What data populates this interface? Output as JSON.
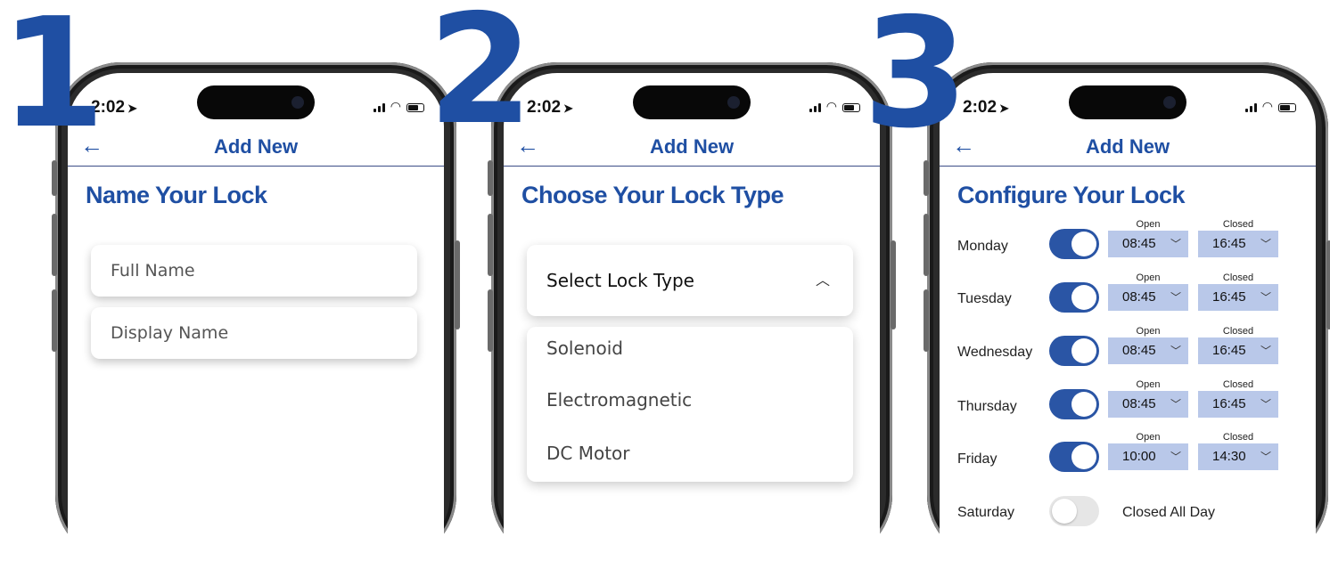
{
  "status": {
    "time": "2:02"
  },
  "nav": {
    "back_icon": "←",
    "title": "Add New"
  },
  "steps": [
    "1",
    "2",
    "3"
  ],
  "screen1": {
    "heading": "Name Your Lock",
    "full_name_placeholder": "Full Name",
    "display_name_placeholder": "Display Name"
  },
  "screen2": {
    "heading": "Choose Your Lock Type",
    "select_label": "Select Lock Type",
    "options": [
      "Solenoid",
      "Electromagnetic",
      "DC Motor"
    ]
  },
  "screen3": {
    "heading": "Configure Your Lock",
    "open_label": "Open",
    "closed_label": "Closed",
    "closed_all_day": "Closed All Day",
    "days": [
      {
        "name": "Monday",
        "enabled": true,
        "open": "08:45",
        "closed": "16:45"
      },
      {
        "name": "Tuesday",
        "enabled": true,
        "open": "08:45",
        "closed": "16:45"
      },
      {
        "name": "Wednesday",
        "enabled": true,
        "open": "08:45",
        "closed": "16:45"
      },
      {
        "name": "Thursday",
        "enabled": true,
        "open": "08:45",
        "closed": "16:45"
      },
      {
        "name": "Friday",
        "enabled": true,
        "open": "10:00",
        "closed": "14:30"
      },
      {
        "name": "Saturday",
        "enabled": false
      }
    ]
  },
  "colors": {
    "accent": "#1f4fa3",
    "toggle_on": "#2a55a5",
    "time_box": "#b9c8e9"
  }
}
